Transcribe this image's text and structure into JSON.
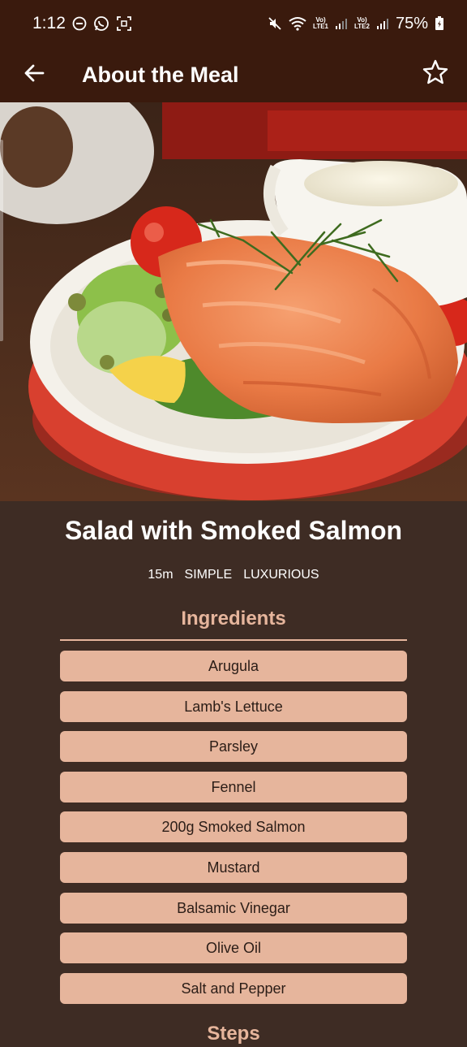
{
  "status_bar": {
    "time": "1:12",
    "battery": "75%",
    "net1": "Vo)\nLTE1",
    "net2": "Vo)\nLTE2"
  },
  "app_bar": {
    "title": "About the Meal"
  },
  "meal": {
    "title": "Salad with Smoked Salmon",
    "duration": "15m",
    "complexity": "SIMPLE",
    "affordability": "LUXURIOUS"
  },
  "ingredients": {
    "heading": "Ingredients",
    "items": [
      "Arugula",
      "Lamb's Lettuce",
      "Parsley",
      "Fennel",
      "200g Smoked Salmon",
      "Mustard",
      "Balsamic Vinegar",
      "Olive Oil",
      "Salt and Pepper"
    ]
  },
  "steps": {
    "heading": "Steps"
  },
  "colors": {
    "app_bar": "#3a1a0d",
    "background": "#3e2c24",
    "accent": "#e6b59c",
    "text_on_accent": "#2b1d17"
  }
}
